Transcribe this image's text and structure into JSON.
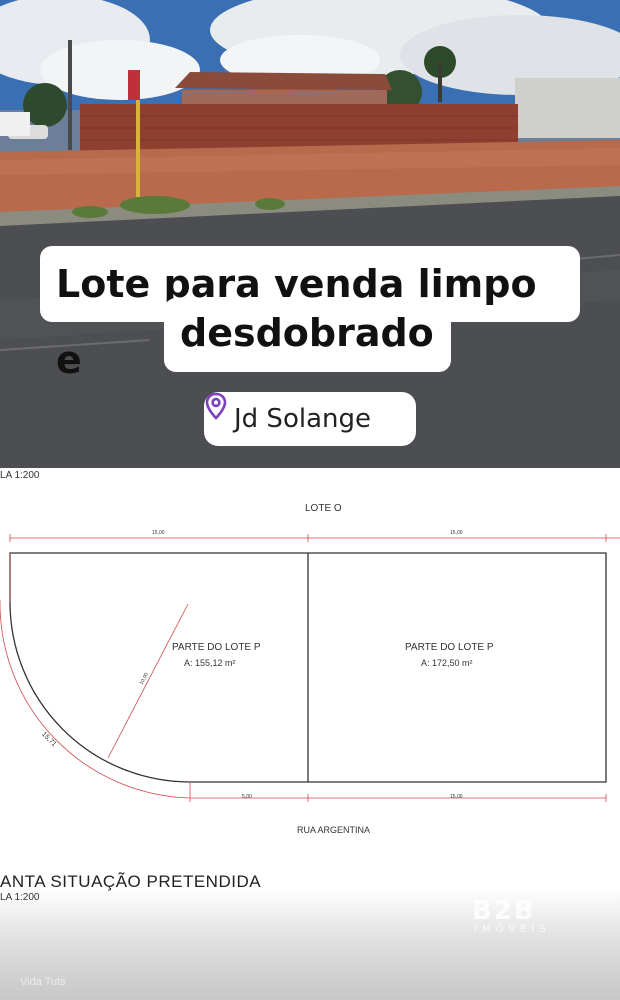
{
  "photo": {
    "headline_line1": "Lote para venda limpo e",
    "headline_line2": "desdobrado",
    "location_label": "Jd Solange",
    "location_icon": "map-pin-icon",
    "accent_color": "#7b3fbf"
  },
  "plan": {
    "scale_top": "LA 1:200",
    "lote_o": "LOTE O",
    "street": "RUA ARGENTINA",
    "lots": [
      {
        "name": "PARTE DO LOTE P",
        "area": "A: 155,12 m²"
      },
      {
        "name": "PARTE DO LOTE P",
        "area": "A: 172,50 m²"
      }
    ],
    "dim_top_left": "15,00",
    "dim_top_right": "15,00",
    "dim_bottom_left": "5,00",
    "dim_bottom_right": "15,00",
    "dim_radius": "10,00",
    "dim_arc": "15,71",
    "title": "ANTA SITUAÇÃO PRETENDIDA",
    "scale_bottom": "LA 1:200"
  },
  "watermark": {
    "brand": "B2B",
    "sub": "IMÓVEIS"
  },
  "footer": {
    "hint": "Vida Tuts"
  }
}
